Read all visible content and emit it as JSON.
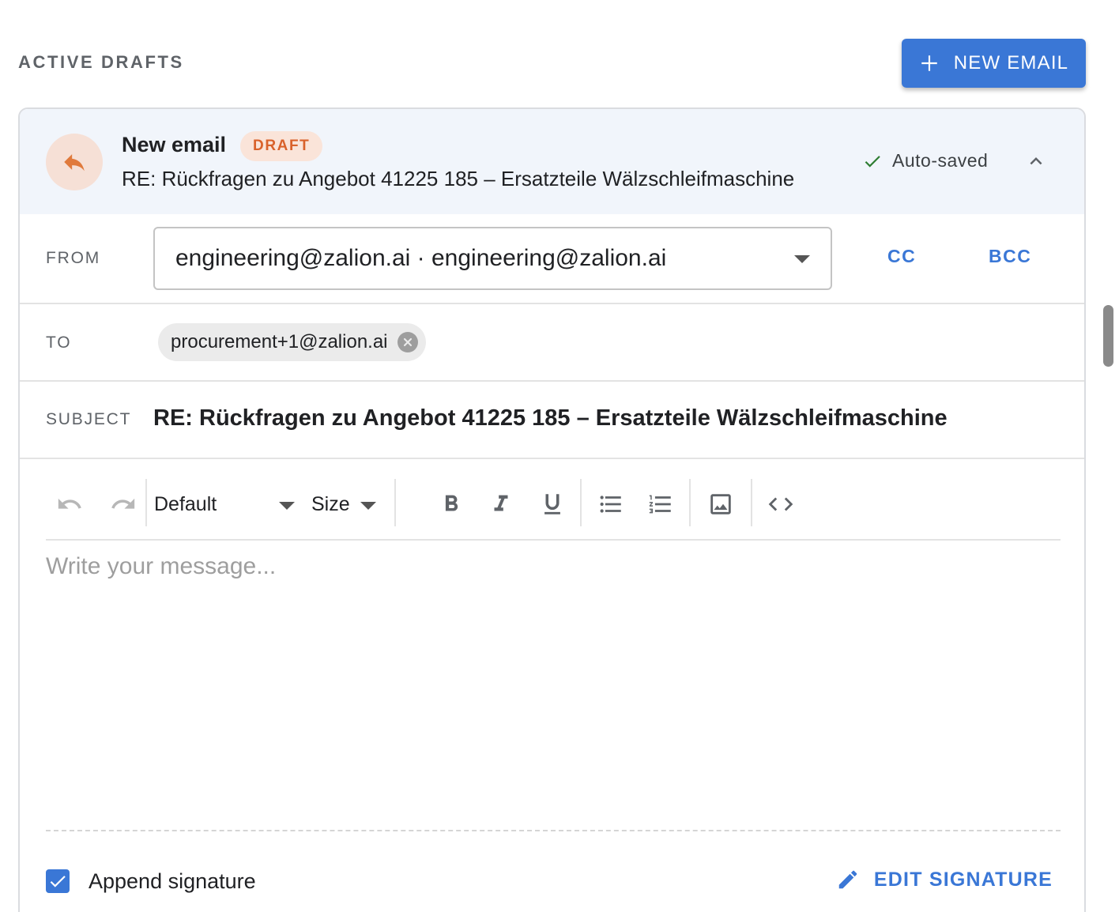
{
  "section": {
    "title": "ACTIVE DRAFTS"
  },
  "actions": {
    "new_email_label": "NEW EMAIL"
  },
  "draft": {
    "title": "New email",
    "badge": "DRAFT",
    "subject_preview": "RE: Rückfragen zu Angebot 41225 185 – Ersatzteile Wälzschleifmaschine",
    "status": "Auto-saved",
    "from": {
      "label": "FROM",
      "value": "engineering@zalion.ai · engineering@zalion.ai"
    },
    "cc_label": "CC",
    "bcc_label": "BCC",
    "to": {
      "label": "TO",
      "recipients": [
        "procurement+1@zalion.ai"
      ]
    },
    "subject": {
      "label": "SUBJECT",
      "value": "RE: Rückfragen zu Angebot 41225 185 – Ersatzteile Wälzschleifmaschine"
    },
    "toolbar": {
      "font": "Default",
      "size": "Size",
      "icons": [
        "undo-icon",
        "redo-icon",
        "bold-icon",
        "italic-icon",
        "underline-icon",
        "bulleted-list-icon",
        "numbered-list-icon",
        "image-icon",
        "code-icon"
      ]
    },
    "body": {
      "placeholder": "Write your message..."
    },
    "signature": {
      "append_label": "Append signature",
      "append_checked": true,
      "edit_label": "EDIT SIGNATURE"
    }
  },
  "colors": {
    "accent": "#3a77d6",
    "draft_badge_bg": "#fae4d9",
    "draft_badge_text": "#d9622b",
    "header_bg": "#f1f5fb",
    "success": "#2e7d32"
  }
}
